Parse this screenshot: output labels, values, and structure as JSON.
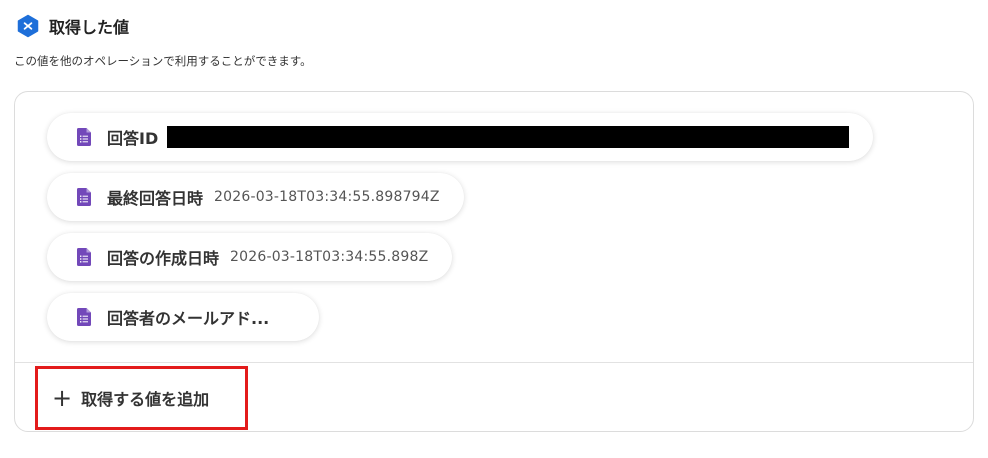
{
  "section": {
    "title": "取得した値",
    "description": "この値を他のオペレーションで利用することができます。",
    "icon": "variable-hex-icon",
    "icon_color": "#1e6fd9"
  },
  "chips": [
    {
      "label": "回答ID",
      "value": "",
      "icon": "google-forms-doc-icon",
      "value_redacted": true
    },
    {
      "label": "最終回答日時",
      "value": "2026-03-18T03:34:55.898794Z",
      "icon": "google-forms-doc-icon"
    },
    {
      "label": "回答の作成日時",
      "value": "2026-03-18T03:34:55.898Z",
      "icon": "google-forms-doc-icon"
    },
    {
      "label": "回答者のメールアド...",
      "value": "",
      "icon": "google-forms-doc-icon"
    }
  ],
  "add_button": {
    "label": "取得する値を追加",
    "icon": "plus-icon",
    "highlight_color": "#e31b1b"
  },
  "colors": {
    "forms_purple": "#7248b9"
  }
}
